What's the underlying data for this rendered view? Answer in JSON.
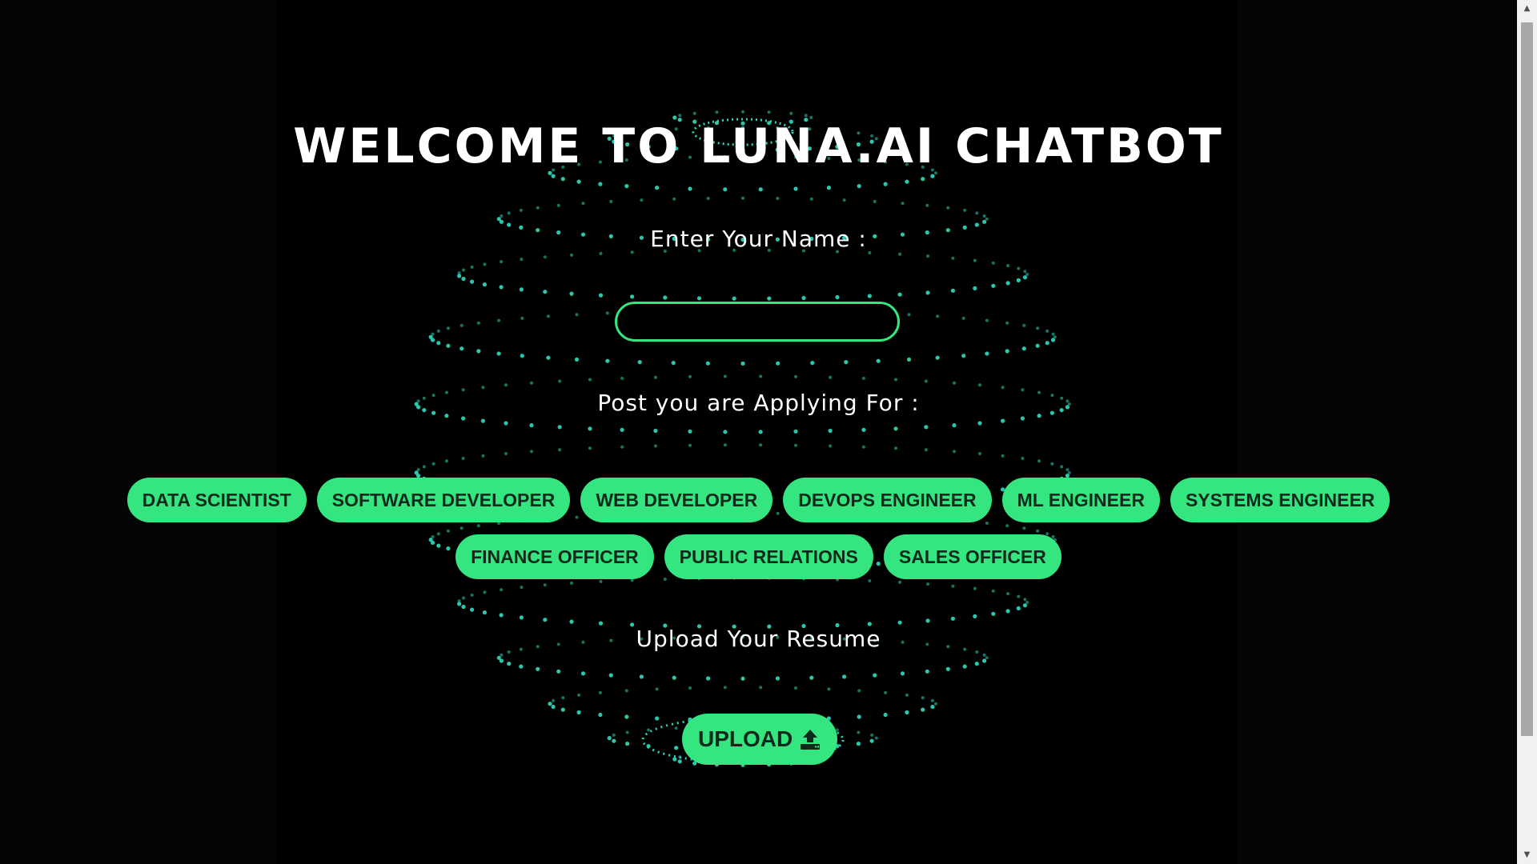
{
  "page": {
    "title": "WELCOME TO LUNA.AI CHATBOT"
  },
  "form": {
    "name_label": "Enter Your Name :",
    "name_value": "",
    "post_label": "Post you are Applying For :",
    "posts": [
      "DATA SCIENTIST",
      "SOFTWARE DEVELOPER",
      "WEB DEVELOPER",
      "DEVOPS ENGINEER",
      "ML ENGINEER",
      "SYSTEMS ENGINEER",
      "FINANCE OFFICER",
      "PUBLIC RELATIONS",
      "SALES OFFICER"
    ],
    "resume_label": "Upload Your Resume",
    "upload_label": "UPLOAD",
    "upload_icon": "upload-icon"
  },
  "scrollbar": {
    "up_arrow": "▲",
    "down_arrow": "▼"
  },
  "colors": {
    "accent": "#35e57f",
    "background": "#000000",
    "text": "#ffffff",
    "button_text": "#0f2a1c",
    "sphere_dots": "#2ed1b5"
  }
}
